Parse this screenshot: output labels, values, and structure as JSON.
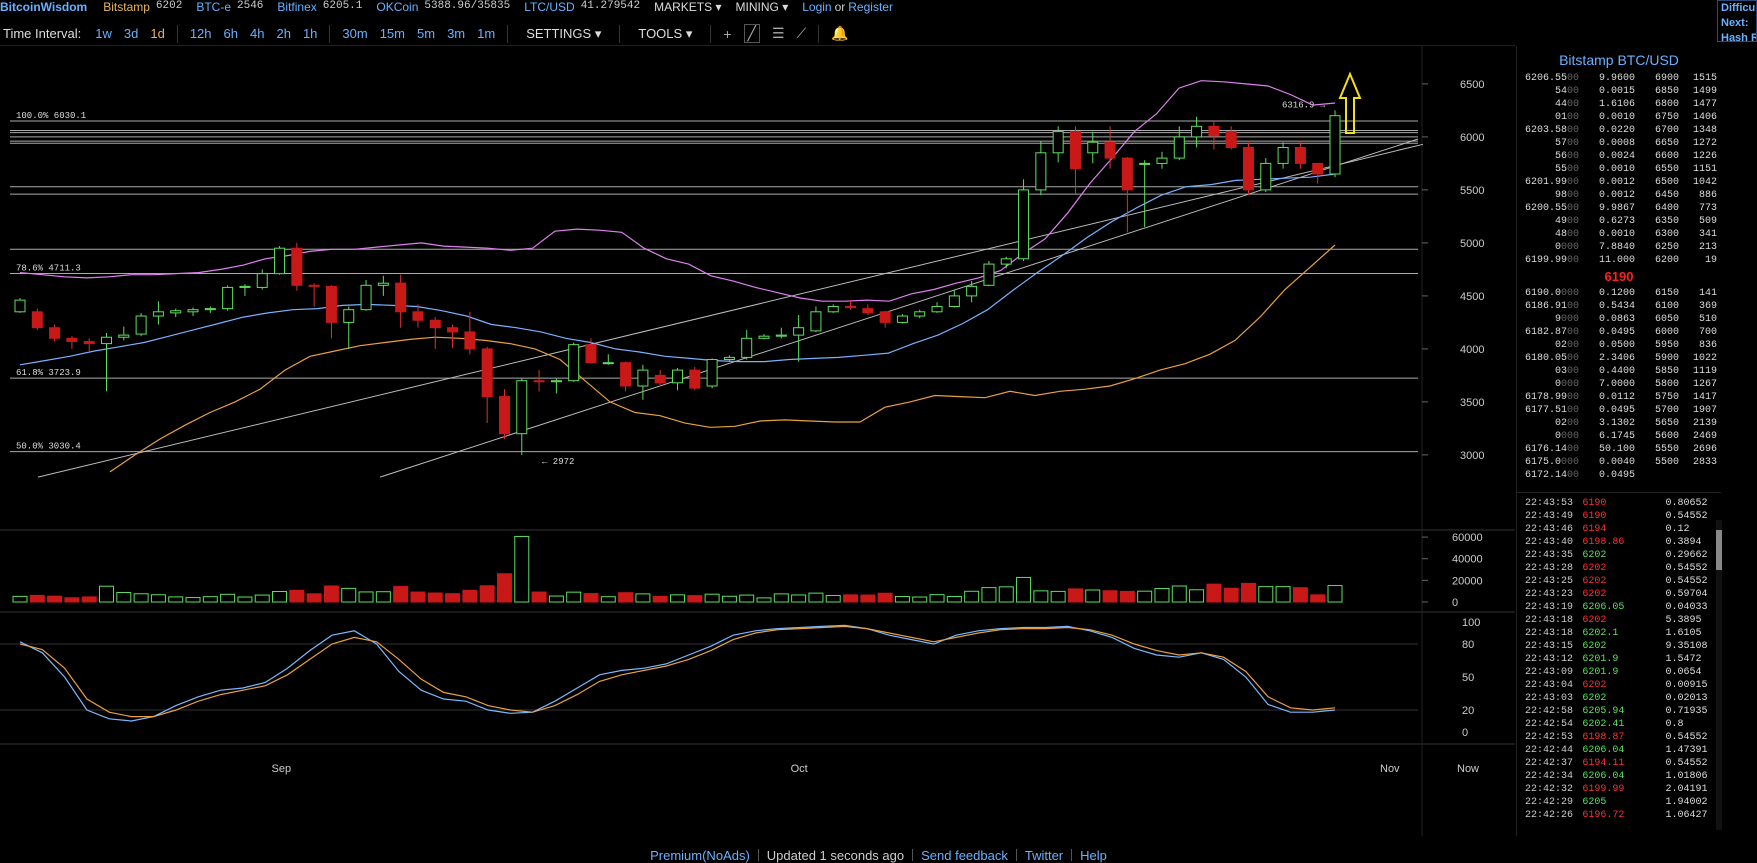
{
  "header": {
    "logo": "BitcoinWisdom",
    "tickers": [
      {
        "exchange": "Bitstamp",
        "value": "6202",
        "style": "orange"
      },
      {
        "exchange": "BTC-e",
        "value": "2546",
        "style": "blue"
      },
      {
        "exchange": "Bitfinex",
        "value": "6205.1",
        "style": "blue"
      },
      {
        "exchange": "OKCoin",
        "value": "5388.96/35835",
        "style": "blue"
      },
      {
        "exchange": "LTC/USD",
        "value": "41.279542",
        "style": "blue"
      }
    ],
    "markets": "MARKETS",
    "mining": "MINING",
    "login": "Login",
    "or": "or",
    "register": "Register"
  },
  "sidebox": {
    "lines": [
      "Difficu",
      "Next:",
      "Hash R"
    ]
  },
  "toolbar": {
    "label": "Time Interval:",
    "intervals": [
      "1w",
      "3d",
      "1d",
      "12h",
      "6h",
      "4h",
      "2h",
      "1h",
      "30m",
      "15m",
      "5m",
      "3m",
      "1m"
    ],
    "active": "1d",
    "settings": "SETTINGS",
    "tools": "TOOLS",
    "icons": [
      "crosshair-icon",
      "line-tool-icon",
      "fib-tool-icon",
      "trend-tool-icon",
      "bell-icon"
    ]
  },
  "colors": {
    "up": "#5ce05c",
    "down": "#c81818",
    "bb": "#e080f0",
    "mid": "#7ab0ff",
    "ma": "#e8a040",
    "k": "#7ab8ff",
    "d": "#e8a040",
    "accent": "#6ab0ff",
    "arrow": "#f0e020"
  },
  "chart_data": {
    "type": "candlestick",
    "pair": "Bitstamp BTC/USD",
    "price_axis": {
      "ticks": [
        3000,
        3500,
        4000,
        4500,
        5000,
        5500,
        6000,
        6500
      ],
      "range": [
        2650,
        6650
      ]
    },
    "volume_axis": {
      "ticks": [
        0,
        20000,
        40000,
        60000
      ],
      "range": [
        0,
        61000
      ]
    },
    "stoch_axis": {
      "ticks": [
        0,
        20,
        50,
        80,
        100
      ],
      "range": [
        0,
        100
      ]
    },
    "x_labels": [
      {
        "label": "Sep",
        "index": 15
      },
      {
        "label": "Oct",
        "index": 45
      },
      {
        "label": "Nov",
        "index": 76
      },
      {
        "label": "Now",
        "index": 80
      }
    ],
    "candles": [
      [
        4350,
        4460,
        4340,
        4480,
        5200
      ],
      [
        4350,
        4200,
        4180,
        4380,
        6100
      ],
      [
        4200,
        4100,
        4070,
        4230,
        5400
      ],
      [
        4100,
        4070,
        4000,
        4120,
        3900
      ],
      [
        4070,
        4050,
        3980,
        4100,
        4700
      ],
      [
        4050,
        4110,
        3600,
        4150,
        14600
      ],
      [
        4110,
        4130,
        4080,
        4210,
        8800
      ],
      [
        4140,
        4310,
        4120,
        4340,
        7600
      ],
      [
        4310,
        4350,
        4230,
        4450,
        6700
      ],
      [
        4340,
        4360,
        4300,
        4380,
        4700
      ],
      [
        4350,
        4370,
        4310,
        4390,
        4100
      ],
      [
        4370,
        4380,
        4340,
        4400,
        4900
      ],
      [
        4380,
        4580,
        4360,
        4600,
        7100
      ],
      [
        4580,
        4590,
        4500,
        4610,
        4600
      ],
      [
        4580,
        4710,
        4560,
        4750,
        6400
      ],
      [
        4710,
        4950,
        4700,
        4970,
        9700
      ],
      [
        4950,
        4600,
        4550,
        5000,
        10800
      ],
      [
        4600,
        4590,
        4400,
        4620,
        7600
      ],
      [
        4590,
        4250,
        4100,
        4600,
        14800
      ],
      [
        4250,
        4370,
        4000,
        4400,
        12600
      ],
      [
        4370,
        4600,
        4360,
        4650,
        9300
      ],
      [
        4600,
        4620,
        4500,
        4690,
        9500
      ],
      [
        4620,
        4350,
        4200,
        4700,
        14300
      ],
      [
        4350,
        4270,
        4200,
        4420,
        9200
      ],
      [
        4270,
        4200,
        4000,
        4300,
        8300
      ],
      [
        4200,
        4160,
        4010,
        4230,
        7700
      ],
      [
        4160,
        4000,
        3950,
        4350,
        10800
      ],
      [
        4000,
        3550,
        3300,
        4020,
        15000
      ],
      [
        3550,
        3200,
        3150,
        3620,
        26100
      ],
      [
        3200,
        3700,
        3000,
        3720,
        60600
      ],
      [
        3700,
        3690,
        3600,
        3800,
        9200
      ],
      [
        3690,
        3700,
        3580,
        3720,
        5500
      ],
      [
        3700,
        4040,
        3690,
        4060,
        9100
      ],
      [
        4040,
        3870,
        3860,
        4100,
        7800
      ],
      [
        3870,
        3870,
        3850,
        3950,
        4900
      ],
      [
        3870,
        3650,
        3600,
        3880,
        8600
      ],
      [
        3650,
        3800,
        3520,
        3850,
        7500
      ],
      [
        3750,
        3680,
        3650,
        3800,
        5200
      ],
      [
        3680,
        3800,
        3610,
        3820,
        6600
      ],
      [
        3800,
        3630,
        3610,
        3830,
        5900
      ],
      [
        3650,
        3900,
        3630,
        3910,
        7200
      ],
      [
        3900,
        3920,
        3880,
        3940,
        5300
      ],
      [
        3920,
        4100,
        3900,
        4180,
        6400
      ],
      [
        4100,
        4120,
        4090,
        4140,
        3800
      ],
      [
        4120,
        4130,
        4100,
        4200,
        7500
      ],
      [
        4130,
        4200,
        3880,
        4320,
        6500
      ],
      [
        4170,
        4350,
        4160,
        4400,
        8200
      ],
      [
        4350,
        4400,
        4340,
        4420,
        6000
      ],
      [
        4400,
        4390,
        4370,
        4460,
        6600
      ],
      [
        4380,
        4340,
        4320,
        4420,
        6400
      ],
      [
        4350,
        4250,
        4200,
        4360,
        8100
      ],
      [
        4250,
        4310,
        4240,
        4330,
        5100
      ],
      [
        4310,
        4350,
        4290,
        4370,
        4600
      ],
      [
        4350,
        4400,
        4340,
        4440,
        6800
      ],
      [
        4400,
        4500,
        4390,
        4550,
        5100
      ],
      [
        4500,
        4590,
        4440,
        4640,
        9900
      ],
      [
        4600,
        4800,
        4590,
        4830,
        13300
      ],
      [
        4800,
        4850,
        4760,
        4870,
        14000
      ],
      [
        4850,
        5500,
        4830,
        5600,
        22700
      ],
      [
        5500,
        5850,
        5450,
        5960,
        10300
      ],
      [
        5850,
        6050,
        5760,
        6100,
        9800
      ],
      [
        6050,
        5700,
        5450,
        6100,
        12100
      ],
      [
        5850,
        5950,
        5750,
        6050,
        11100
      ],
      [
        5950,
        5800,
        5700,
        6100,
        10400
      ],
      [
        5800,
        5500,
        5100,
        5810,
        9800
      ],
      [
        5750,
        5750,
        5150,
        5780,
        10000
      ],
      [
        5750,
        5800,
        5700,
        5860,
        12500
      ],
      [
        5800,
        6000,
        5780,
        6100,
        14800
      ],
      [
        6000,
        6100,
        5900,
        6190,
        11300
      ],
      [
        6100,
        6010,
        5880,
        6150,
        16500
      ],
      [
        6050,
        5900,
        5880,
        6100,
        12700
      ],
      [
        5900,
        5500,
        5450,
        5950,
        17200
      ],
      [
        5500,
        5750,
        5480,
        5800,
        14200
      ],
      [
        5750,
        5900,
        5700,
        5950,
        14200
      ],
      [
        5900,
        5750,
        5700,
        5960,
        13200
      ],
      [
        5750,
        5650,
        5560,
        5750,
        6600
      ],
      [
        5650,
        6200,
        5620,
        6250,
        15200
      ]
    ],
    "ma_lines": {
      "bb_upper": [
        4720,
        4700,
        4680,
        4670,
        4680,
        4700,
        4700,
        4710,
        4720,
        4750,
        4790,
        4850,
        4880,
        4920,
        4940,
        4940,
        4960,
        4980,
        5000,
        4970,
        4960,
        4950,
        4930,
        4950,
        5110,
        5130,
        5120,
        5100,
        4950,
        4850,
        4800,
        4690,
        4640,
        4580,
        4530,
        4480,
        4450,
        4450,
        4460,
        4450,
        4520,
        4560,
        4620,
        4670,
        4740,
        4900,
        5040,
        5280,
        5560,
        5800,
        6050,
        6220,
        6460,
        6530,
        6520,
        6500,
        6480,
        6400,
        6300,
        6320
      ],
      "bb_mid": [
        3850,
        3890,
        3930,
        3980,
        4020,
        4060,
        4120,
        4180,
        4240,
        4300,
        4340,
        4370,
        4380,
        4410,
        4420,
        4410,
        4400,
        4360,
        4310,
        4230,
        4200,
        4160,
        4100,
        4060,
        4000,
        3970,
        3930,
        3910,
        3890,
        3880,
        3880,
        3900,
        3910,
        3920,
        3940,
        3960,
        4050,
        4130,
        4240,
        4370,
        4550,
        4720,
        4880,
        5050,
        5200,
        5330,
        5450,
        5530,
        5550,
        5590,
        5600,
        5610,
        5620,
        5650
      ],
      "ma_slow": [
        2840,
        3000,
        3150,
        3280,
        3400,
        3500,
        3620,
        3800,
        3930,
        3980,
        4030,
        4060,
        4090,
        4110,
        4100,
        4080,
        4050,
        4000,
        3900,
        3700,
        3500,
        3400,
        3370,
        3300,
        3260,
        3270,
        3320,
        3330,
        3320,
        3310,
        3310,
        3450,
        3500,
        3560,
        3550,
        3540,
        3600,
        3560,
        3600,
        3620,
        3650,
        3720,
        3800,
        3860,
        3950,
        4080,
        4300,
        4560,
        4770,
        4980
      ],
      "bb_upper_idx": [
        0,
        2,
        4,
        6,
        8,
        10,
        12,
        14,
        16,
        18,
        20,
        22,
        24,
        26,
        28,
        29,
        30,
        32,
        34,
        36,
        38,
        40,
        42,
        44,
        46,
        48,
        50,
        52,
        54,
        56,
        58,
        60,
        62,
        64,
        66,
        68,
        70,
        72,
        74,
        76,
        78,
        80,
        82,
        84,
        86,
        88,
        90,
        92,
        94,
        96,
        98,
        100,
        102,
        104,
        106,
        108,
        110,
        112,
        114,
        116
      ],
      "line_label_peak": "6316.9"
    },
    "stoch_k": [
      82,
      72,
      50,
      20,
      12,
      10,
      14,
      24,
      32,
      38,
      40,
      45,
      58,
      74,
      88,
      92,
      80,
      55,
      38,
      30,
      28,
      20,
      17,
      18,
      28,
      40,
      52,
      56,
      58,
      62,
      70,
      78,
      88,
      92,
      94,
      95,
      96,
      97,
      94,
      88,
      84,
      80,
      88,
      92,
      94,
      95,
      95,
      96,
      92,
      86,
      76,
      70,
      68,
      72,
      66,
      50,
      25,
      18,
      18,
      20
    ],
    "stoch_d": [
      80,
      75,
      58,
      30,
      18,
      14,
      14,
      20,
      28,
      34,
      38,
      42,
      52,
      66,
      80,
      86,
      82,
      66,
      48,
      36,
      32,
      24,
      20,
      18,
      24,
      34,
      46,
      52,
      56,
      60,
      66,
      74,
      84,
      90,
      93,
      94,
      95,
      96,
      94,
      90,
      86,
      82,
      86,
      90,
      93,
      94,
      94,
      95,
      93,
      88,
      80,
      74,
      70,
      72,
      68,
      55,
      32,
      22,
      20,
      22
    ],
    "annotations": [
      {
        "text": "100.0% 6030.1",
        "price": 6150
      },
      {
        "text": "78.6% 4711.3",
        "price": 4711.3
      },
      {
        "text": "61.8% 3723.9",
        "price": 3723.9
      },
      {
        "text": "50.0% 3030.4",
        "price": 3030.4
      },
      {
        "text": "← 2972",
        "price": 2972
      },
      {
        "text": "6316.9 →",
        "price": 6316.9
      }
    ],
    "h_lines": [
      6150,
      6060,
      6040,
      6000,
      5960,
      5940,
      5530,
      5460,
      4940,
      4711.3,
      3723.9,
      3030.4
    ]
  },
  "orderbook": {
    "title": "Bitstamp BTC/USD",
    "asks": [
      [
        "6206.55",
        "00",
        "9.9600",
        "6900",
        "1515"
      ],
      [
        "54",
        "00",
        "0.0015",
        "6850",
        "1499"
      ],
      [
        "44",
        "00",
        "1.6106",
        "6800",
        "1477"
      ],
      [
        "01",
        "00",
        "0.0010",
        "6750",
        "1406"
      ],
      [
        "6203.58",
        "00",
        "0.0220",
        "6700",
        "1348"
      ],
      [
        "57",
        "00",
        "0.0008",
        "6650",
        "1272"
      ],
      [
        "56",
        "00",
        "0.0024",
        "6600",
        "1226"
      ],
      [
        "55",
        "00",
        "0.0010",
        "6550",
        "1151"
      ],
      [
        "6201.99",
        "00",
        "0.0012",
        "6500",
        "1042"
      ],
      [
        "98",
        "00",
        "0.0012",
        "6450",
        "886"
      ],
      [
        "6200.55",
        "00",
        "9.9867",
        "6400",
        "773"
      ],
      [
        "49",
        "00",
        "0.6273",
        "6350",
        "509"
      ],
      [
        "48",
        "00",
        "0.0010",
        "6300",
        "341"
      ],
      [
        "0",
        "000",
        "7.8840",
        "6250",
        "213"
      ],
      [
        "6199.99",
        "00",
        "11.000",
        "6200",
        "19"
      ]
    ],
    "last": "6190",
    "bids": [
      [
        "6190.0",
        "000",
        "0.1200",
        "6150",
        "141"
      ],
      [
        "6186.91",
        "00",
        "0.5434",
        "6100",
        "369"
      ],
      [
        "9",
        "000",
        "0.0863",
        "6050",
        "510"
      ],
      [
        "6182.87",
        "00",
        "0.0495",
        "6000",
        "700"
      ],
      [
        "02",
        "00",
        "0.0500",
        "5950",
        "836"
      ],
      [
        "6180.05",
        "00",
        "2.3406",
        "5900",
        "1022"
      ],
      [
        "03",
        "00",
        "0.4400",
        "5850",
        "1119"
      ],
      [
        "0",
        "000",
        "7.0000",
        "5800",
        "1267"
      ],
      [
        "6178.99",
        "00",
        "0.0112",
        "5750",
        "1417"
      ],
      [
        "6177.51",
        "00",
        "0.0495",
        "5700",
        "1907"
      ],
      [
        "02",
        "00",
        "3.1302",
        "5650",
        "2139"
      ],
      [
        "0",
        "000",
        "6.1745",
        "5600",
        "2469"
      ],
      [
        "6176.14",
        "00",
        "50.100",
        "5550",
        "2696"
      ],
      [
        "6175.0",
        "000",
        "0.0040",
        "5500",
        "2833"
      ],
      [
        "6172.14",
        "00",
        "0.0495",
        "",
        ""
      ]
    ],
    "trades": [
      [
        "22:43:53",
        "6190",
        "0.80652",
        "dn"
      ],
      [
        "22:43:49",
        "6190",
        "0.54552",
        "dn"
      ],
      [
        "22:43:46",
        "6194",
        "0.12",
        "dn"
      ],
      [
        "22:43:40",
        "6198.86",
        "0.3894",
        "dn"
      ],
      [
        "22:43:35",
        "6202",
        "0.29662",
        "up"
      ],
      [
        "22:43:28",
        "6202",
        "0.54552",
        "dn"
      ],
      [
        "22:43:25",
        "6202",
        "0.54552",
        "dn"
      ],
      [
        "22:43:23",
        "6202",
        "0.59704",
        "dn"
      ],
      [
        "22:43:19",
        "6206.05",
        "0.04033",
        "up"
      ],
      [
        "22:43:18",
        "6202",
        "5.3895",
        "dn"
      ],
      [
        "22:43:18",
        "6202.1",
        "1.6105",
        "up"
      ],
      [
        "22:43:15",
        "6202",
        "9.35108",
        "up"
      ],
      [
        "22:43:12",
        "6201.9",
        "1.5472",
        "up"
      ],
      [
        "22:43:09",
        "6201.9",
        "0.0654",
        "up"
      ],
      [
        "22:43:04",
        "6202",
        "0.00915",
        "dn"
      ],
      [
        "22:43:03",
        "6202",
        "0.02013",
        "up"
      ],
      [
        "22:42:58",
        "6205.94",
        "0.71935",
        "up"
      ],
      [
        "22:42:54",
        "6202.41",
        "0.8",
        "up"
      ],
      [
        "22:42:53",
        "6198.87",
        "0.54552",
        "dn"
      ],
      [
        "22:42:44",
        "6206.04",
        "1.47391",
        "up"
      ],
      [
        "22:42:37",
        "6194.11",
        "0.54552",
        "dn"
      ],
      [
        "22:42:34",
        "6206.04",
        "1.01806",
        "up"
      ],
      [
        "22:42:32",
        "6199.99",
        "2.04191",
        "dn"
      ],
      [
        "22:42:29",
        "6205",
        "1.94002",
        "up"
      ],
      [
        "22:42:26",
        "6196.72",
        "1.06427",
        "dn"
      ]
    ]
  },
  "footer": {
    "premium": "Premium(NoAds)",
    "updated": "Updated 1 seconds ago",
    "feedback": "Send feedback",
    "twitter": "Twitter",
    "help": "Help"
  }
}
